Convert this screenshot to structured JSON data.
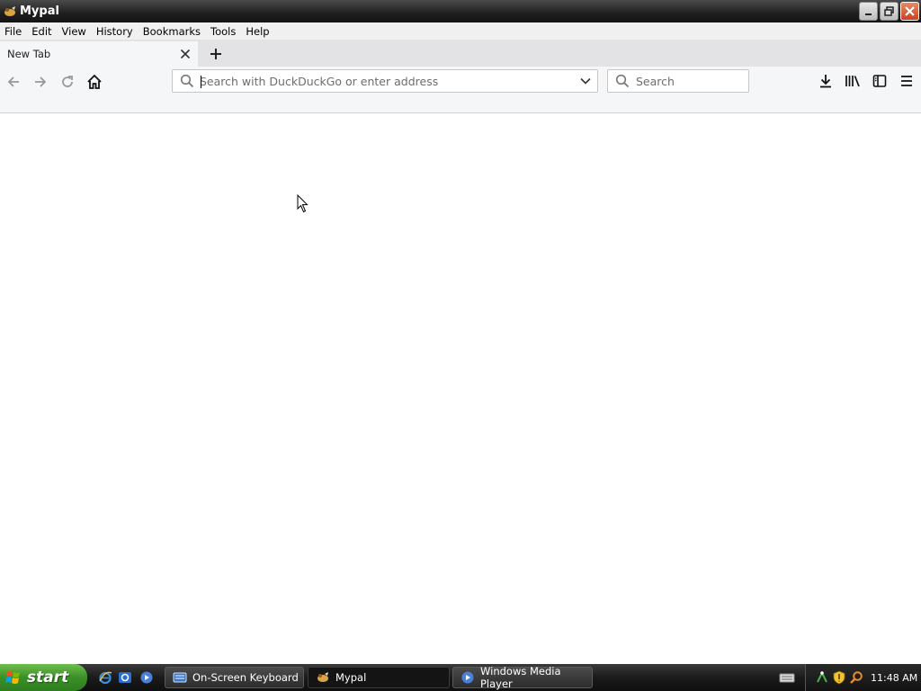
{
  "window": {
    "title": "Mypal"
  },
  "menu": [
    "File",
    "Edit",
    "View",
    "History",
    "Bookmarks",
    "Tools",
    "Help"
  ],
  "tabs": [
    {
      "label": "New Tab"
    }
  ],
  "urlbar": {
    "placeholder": "Search with DuckDuckGo or enter address",
    "value": ""
  },
  "searchbar": {
    "placeholder": "Search"
  },
  "taskbar": {
    "start_label": "start",
    "tasks": [
      {
        "label": "On-Screen Keyboard"
      },
      {
        "label": "Mypal"
      },
      {
        "label": "Windows Media Player"
      }
    ],
    "clock": "11:48 AM"
  },
  "colors": {
    "accent_start": "#3a8f26",
    "close_button": "#c9431d",
    "titlebar": "#1f1f1f"
  },
  "icons": [
    "app-icon",
    "minimize-icon",
    "restore-icon",
    "close-icon",
    "tab-close-icon",
    "new-tab-icon",
    "back-icon",
    "forward-icon",
    "reload-icon",
    "home-icon",
    "search-icon",
    "dropdown-icon",
    "download-icon",
    "library-icon",
    "sidebar-icon",
    "menu-icon"
  ]
}
